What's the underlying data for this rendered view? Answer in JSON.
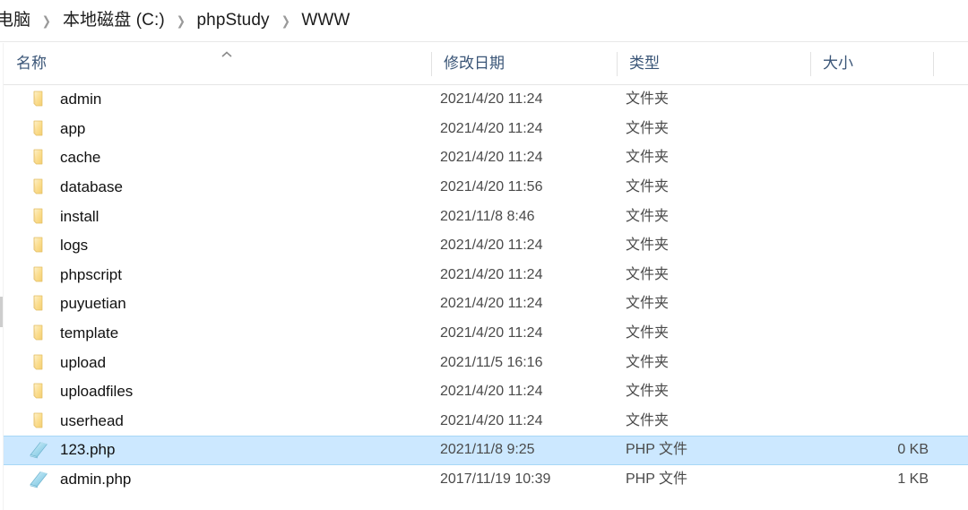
{
  "window": {
    "title": "WWW"
  },
  "breadcrumb": {
    "separator": "❯",
    "items": [
      {
        "label": "电脑"
      },
      {
        "label": "本地磁盘 (C:)"
      },
      {
        "label": "phpStudy"
      },
      {
        "label": "WWW"
      }
    ]
  },
  "columns": [
    {
      "key": "name",
      "label": "名称",
      "sorted": "asc"
    },
    {
      "key": "date",
      "label": "修改日期",
      "sorted": ""
    },
    {
      "key": "type",
      "label": "类型",
      "sorted": ""
    },
    {
      "key": "size",
      "label": "大小",
      "sorted": ""
    }
  ],
  "sort": {
    "column": "名称",
    "direction": "asc",
    "indicator_icon": "chevron-up-icon"
  },
  "icons": {
    "folder": "folder-icon",
    "php_file": "php-file-icon"
  },
  "colors": {
    "selection_fill": "#cce8ff",
    "selection_border": "#a8d8f6",
    "header_text": "#3a5577",
    "folder_yellow": "#fbdd8c",
    "php_blue": "#9fd8ee"
  },
  "files": [
    {
      "name": "admin",
      "date": "2021/4/20 11:24",
      "type": "文件夹",
      "size": "",
      "icon": "folder-icon",
      "selected": false
    },
    {
      "name": "app",
      "date": "2021/4/20 11:24",
      "type": "文件夹",
      "size": "",
      "icon": "folder-icon",
      "selected": false
    },
    {
      "name": "cache",
      "date": "2021/4/20 11:24",
      "type": "文件夹",
      "size": "",
      "icon": "folder-icon",
      "selected": false
    },
    {
      "name": "database",
      "date": "2021/4/20 11:56",
      "type": "文件夹",
      "size": "",
      "icon": "folder-icon",
      "selected": false
    },
    {
      "name": "install",
      "date": "2021/11/8 8:46",
      "type": "文件夹",
      "size": "",
      "icon": "folder-icon",
      "selected": false
    },
    {
      "name": "logs",
      "date": "2021/4/20 11:24",
      "type": "文件夹",
      "size": "",
      "icon": "folder-icon",
      "selected": false
    },
    {
      "name": "phpscript",
      "date": "2021/4/20 11:24",
      "type": "文件夹",
      "size": "",
      "icon": "folder-icon",
      "selected": false
    },
    {
      "name": "puyuetian",
      "date": "2021/4/20 11:24",
      "type": "文件夹",
      "size": "",
      "icon": "folder-icon",
      "selected": false
    },
    {
      "name": "template",
      "date": "2021/4/20 11:24",
      "type": "文件夹",
      "size": "",
      "icon": "folder-icon",
      "selected": false
    },
    {
      "name": "upload",
      "date": "2021/11/5 16:16",
      "type": "文件夹",
      "size": "",
      "icon": "folder-icon",
      "selected": false
    },
    {
      "name": "uploadfiles",
      "date": "2021/4/20 11:24",
      "type": "文件夹",
      "size": "",
      "icon": "folder-icon",
      "selected": false
    },
    {
      "name": "userhead",
      "date": "2021/4/20 11:24",
      "type": "文件夹",
      "size": "",
      "icon": "folder-icon",
      "selected": false
    },
    {
      "name": "123.php",
      "date": "2021/11/8 9:25",
      "type": "PHP 文件",
      "size": "0 KB",
      "icon": "php-file-icon",
      "selected": true
    },
    {
      "name": "admin.php",
      "date": "2017/11/19 10:39",
      "type": "PHP 文件",
      "size": "1 KB",
      "icon": "php-file-icon",
      "selected": false
    }
  ]
}
